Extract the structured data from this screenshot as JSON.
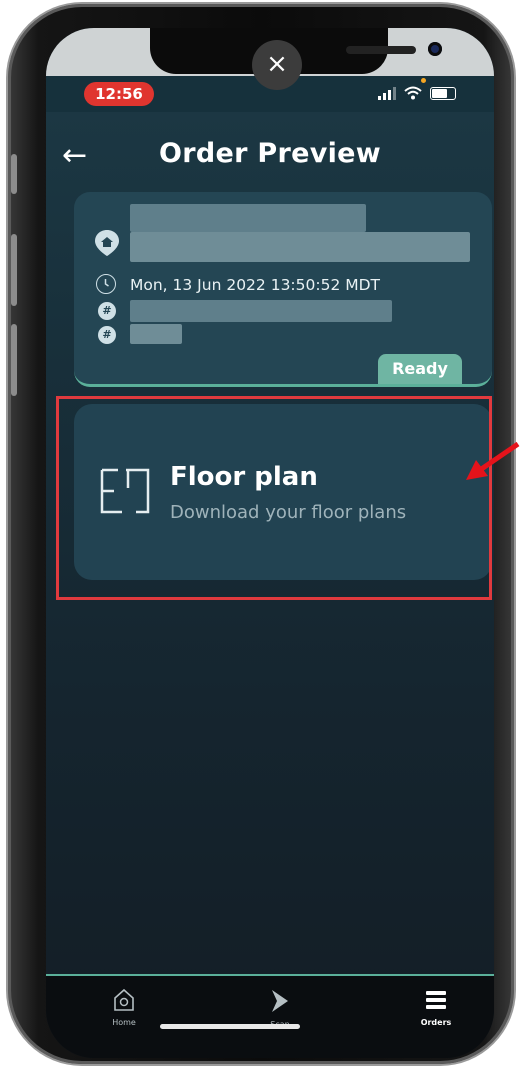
{
  "status_bar": {
    "time": "12:56"
  },
  "overlay": {
    "close_glyph": "×"
  },
  "header": {
    "back_glyph": "←",
    "title": "Order Preview"
  },
  "order_card": {
    "datetime": "Mon, 13 Jun 2022 13:50:52 MDT",
    "status_badge": "Ready",
    "icons": [
      "location-pin-icon",
      "clock-icon",
      "hash-icon",
      "hash-icon"
    ],
    "hash_glyph": "#"
  },
  "floor_plan_card": {
    "title": "Floor plan",
    "subtitle": "Download your floor plans",
    "icon": "floor-plan-icon"
  },
  "tabbar": {
    "items": [
      {
        "label": "Home",
        "icon": "home-icon",
        "active": false
      },
      {
        "label": "Scan",
        "icon": "scan-icon",
        "active": false
      },
      {
        "label": "Orders",
        "icon": "orders-list-icon",
        "active": true
      }
    ]
  },
  "colors": {
    "accent": "#5bb09a",
    "time_pill": "#e0352f",
    "annotation_red": "#e03a3e",
    "background": "#18303b"
  }
}
